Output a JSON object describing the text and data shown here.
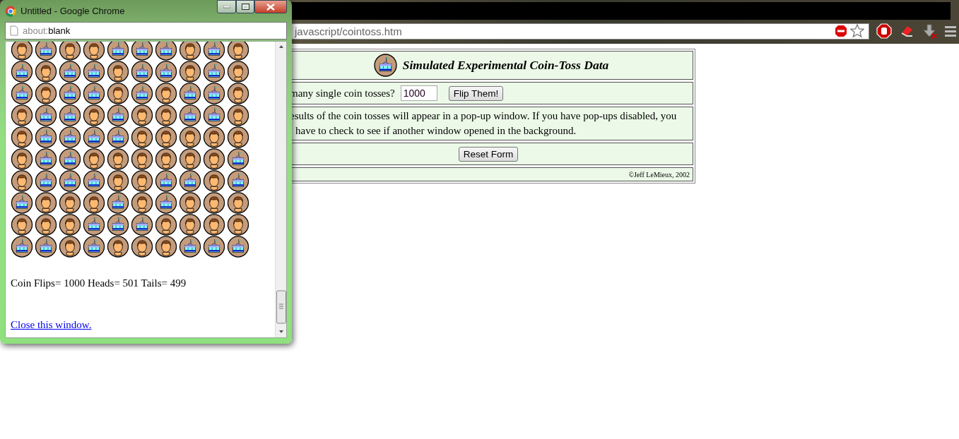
{
  "popup": {
    "title": "Untitled - Google Chrome",
    "address": {
      "scheme": "about:",
      "page": "blank"
    },
    "coin_rows": [
      [
        {
          "kind": "heads"
        },
        {
          "kind": "tails"
        },
        {
          "kind": "heads"
        },
        {
          "kind": "heads"
        },
        {
          "kind": "tails"
        },
        {
          "kind": "tails"
        },
        {
          "kind": "tails"
        },
        {
          "kind": "heads"
        },
        {
          "kind": "tails"
        },
        {
          "kind": "heads"
        }
      ],
      [
        {
          "kind": "tails"
        },
        {
          "kind": "heads"
        },
        {
          "kind": "tails"
        },
        {
          "kind": "tails"
        },
        {
          "kind": "heads"
        },
        {
          "kind": "tails"
        },
        {
          "kind": "tails"
        },
        {
          "kind": "heads"
        },
        {
          "kind": "tails"
        },
        {
          "kind": "heads"
        }
      ],
      [
        {
          "kind": "tails"
        },
        {
          "kind": "heads"
        },
        {
          "kind": "tails"
        },
        {
          "kind": "tails"
        },
        {
          "kind": "heads"
        },
        {
          "kind": "tails"
        },
        {
          "kind": "heads"
        },
        {
          "kind": "tails"
        },
        {
          "kind": "tails"
        },
        {
          "kind": "heads"
        }
      ],
      [
        {
          "kind": "heads"
        },
        {
          "kind": "tails"
        },
        {
          "kind": "tails"
        },
        {
          "kind": "heads"
        },
        {
          "kind": "tails"
        },
        {
          "kind": "heads"
        },
        {
          "kind": "heads"
        },
        {
          "kind": "tails"
        },
        {
          "kind": "tails"
        },
        {
          "kind": "heads"
        }
      ],
      [
        {
          "kind": "heads"
        },
        {
          "kind": "tails"
        },
        {
          "kind": "tails"
        },
        {
          "kind": "tails"
        },
        {
          "kind": "tails"
        },
        {
          "kind": "heads"
        },
        {
          "kind": "heads"
        },
        {
          "kind": "heads"
        },
        {
          "kind": "heads"
        },
        {
          "kind": "heads"
        }
      ],
      [
        {
          "kind": "heads"
        },
        {
          "kind": "tails"
        },
        {
          "kind": "tails"
        },
        {
          "kind": "heads"
        },
        {
          "kind": "heads"
        },
        {
          "kind": "heads"
        },
        {
          "kind": "heads"
        },
        {
          "kind": "heads"
        },
        {
          "kind": "heads"
        },
        {
          "kind": "tails"
        }
      ],
      [
        {
          "kind": "heads"
        },
        {
          "kind": "tails"
        },
        {
          "kind": "tails"
        },
        {
          "kind": "tails"
        },
        {
          "kind": "heads"
        },
        {
          "kind": "heads"
        },
        {
          "kind": "tails"
        },
        {
          "kind": "tails"
        },
        {
          "kind": "heads"
        },
        {
          "kind": "tails"
        }
      ],
      [
        {
          "kind": "tails"
        },
        {
          "kind": "heads"
        },
        {
          "kind": "heads"
        },
        {
          "kind": "heads"
        },
        {
          "kind": "tails"
        },
        {
          "kind": "heads"
        },
        {
          "kind": "tails"
        },
        {
          "kind": "heads"
        },
        {
          "kind": "heads"
        },
        {
          "kind": "heads"
        }
      ],
      [
        {
          "kind": "heads"
        },
        {
          "kind": "heads"
        },
        {
          "kind": "heads"
        },
        {
          "kind": "tails"
        },
        {
          "kind": "tails"
        },
        {
          "kind": "tails"
        },
        {
          "kind": "heads"
        },
        {
          "kind": "heads"
        },
        {
          "kind": "heads"
        },
        {
          "kind": "heads"
        }
      ],
      [
        {
          "kind": "tails"
        },
        {
          "kind": "tails"
        },
        {
          "kind": "heads"
        },
        {
          "kind": "tails"
        },
        {
          "kind": "heads"
        },
        {
          "kind": "heads"
        },
        {
          "kind": "heads"
        },
        {
          "kind": "tails"
        },
        {
          "kind": "tails"
        },
        {
          "kind": "tails"
        }
      ]
    ],
    "summary": "Coin Flips= 1000 Heads= 501 Tails= 499",
    "close_link": "Close this window."
  },
  "browser": {
    "address": "javascript/cointoss.htm"
  },
  "page": {
    "title": "Simulated Experimental Coin-Toss Data",
    "question": "many single coin tosses?",
    "count_value": "1000",
    "flip_button": "Flip Them!",
    "note_lines": [
      "esults of the coin tosses will appear in a pop-up window. If you have pop-ups disabled, you",
      "have to check to see if another window opened in the background."
    ],
    "reset_button": "Reset Form",
    "credit": "©Jeff LeMieux, 2002"
  }
}
